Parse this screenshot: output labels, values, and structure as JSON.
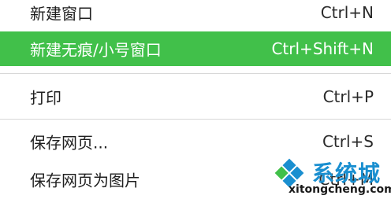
{
  "menu": {
    "items": [
      {
        "label": "新建窗口",
        "shortcut": "Ctrl+N",
        "active": false
      },
      {
        "label": "新建无痕/小号窗口",
        "shortcut": "Ctrl+Shift+N",
        "active": true
      },
      {
        "label": "打印",
        "shortcut": "Ctrl+P",
        "active": false
      },
      {
        "label": "保存网页...",
        "shortcut": "Ctrl+S",
        "active": false
      },
      {
        "label": "保存网页为图片",
        "shortcut": "Ctrl+M",
        "active": false
      }
    ]
  },
  "watermark": {
    "name": "系统城",
    "url": "xitongcheng.com",
    "colors": {
      "blue": "#1a8fd0",
      "green": "#41c04a"
    }
  },
  "colors": {
    "highlight": "#41c04a",
    "separator": "#d8d8d8",
    "text": "#1f1f1f"
  }
}
